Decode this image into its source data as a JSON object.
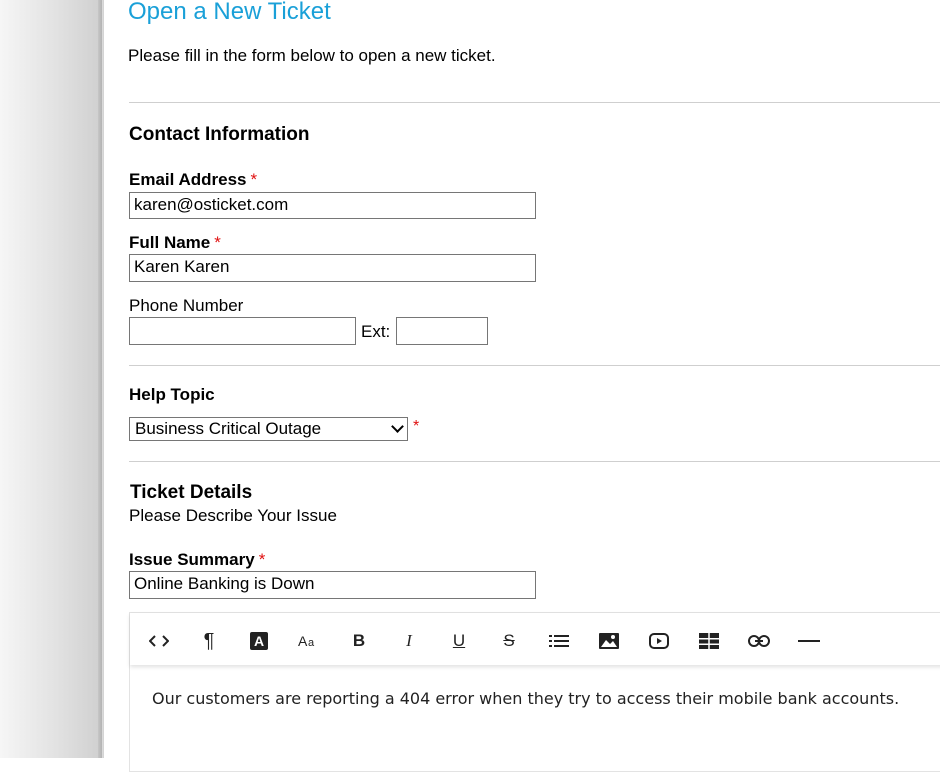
{
  "page": {
    "title": "Open a New Ticket",
    "intro": "Please fill in the form below to open a new ticket."
  },
  "contact": {
    "heading": "Contact Information",
    "email_label": "Email Address",
    "email_value": "karen@osticket.com",
    "name_label": "Full Name",
    "name_value": "Karen Karen",
    "phone_label": "Phone Number",
    "phone_value": "",
    "ext_label": "Ext:",
    "ext_value": "",
    "required_mark": "*"
  },
  "help_topic": {
    "label": "Help Topic",
    "selected": "Business Critical Outage",
    "required_mark": "*"
  },
  "details": {
    "heading": "Ticket Details",
    "subheading": "Please Describe Your Issue",
    "summary_label": "Issue Summary",
    "summary_value": "Online Banking is Down",
    "required_mark": "*"
  },
  "editor": {
    "toolbar": [
      {
        "name": "html-code-icon",
        "glyph": "<>"
      },
      {
        "name": "paragraph-icon",
        "glyph": "¶"
      },
      {
        "name": "font-color-icon",
        "glyph": "A"
      },
      {
        "name": "font-size-icon",
        "glyph": "Aa"
      },
      {
        "name": "bold-icon",
        "glyph": "B"
      },
      {
        "name": "italic-icon",
        "glyph": "I"
      },
      {
        "name": "underline-icon",
        "glyph": "U"
      },
      {
        "name": "strikethrough-icon",
        "glyph": "S"
      },
      {
        "name": "list-icon",
        "glyph": "list"
      },
      {
        "name": "image-icon",
        "glyph": "image"
      },
      {
        "name": "video-icon",
        "glyph": "video"
      },
      {
        "name": "table-icon",
        "glyph": "table"
      },
      {
        "name": "link-icon",
        "glyph": "link"
      },
      {
        "name": "horizontal-rule-icon",
        "glyph": "—"
      }
    ],
    "body": "Our customers are reporting a 404 error when they try to access their mobile bank accounts."
  }
}
